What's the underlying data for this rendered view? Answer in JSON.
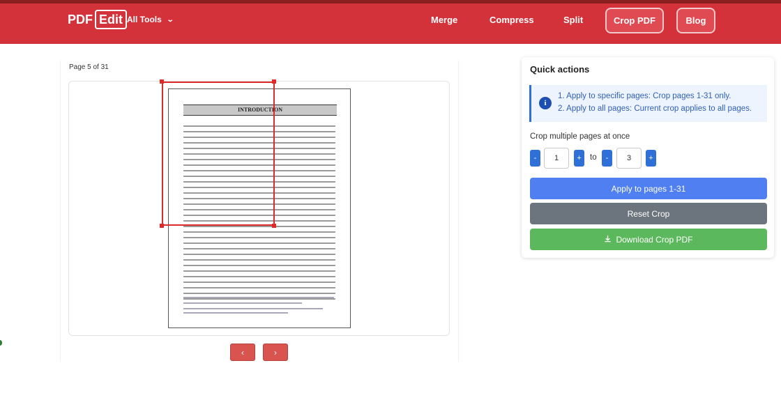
{
  "header": {
    "logo_text": "PDF",
    "logo_boxed": "Edit",
    "all_tools_label": "All Tools",
    "nav_links": [
      "Merge",
      "Compress",
      "Split"
    ],
    "crop_pdf_label": "Crop PDF",
    "blog_label": "Blog"
  },
  "viewer": {
    "page_indicator": "Page 5 of 31",
    "doc_heading": "INTRODUCTION",
    "prev_label": "‹",
    "next_label": "›"
  },
  "quick_actions": {
    "title": "Quick actions",
    "info_icon": "i",
    "info_lines": [
      "1. Apply to specific pages: Crop pages 1-31 only.",
      "2. Apply to all pages: Current crop applies to all pages."
    ],
    "crop_multiple_label": "Crop multiple pages at once",
    "from_value": "1",
    "to_label": "to",
    "to_value": "3",
    "minus_label": "-",
    "plus_label": "+",
    "apply_label": "Apply to pages 1-31",
    "reset_label": "Reset Crop",
    "download_label": "Download Crop PDF"
  },
  "colors": {
    "brand_red": "#d3323a",
    "primary_blue": "#4f7ff0",
    "reset_gray": "#6c757d",
    "download_green": "#5cb85c"
  },
  "icons": [
    "chevron-down-icon",
    "info-icon",
    "download-icon",
    "chevron-left-icon",
    "chevron-right-icon"
  ]
}
